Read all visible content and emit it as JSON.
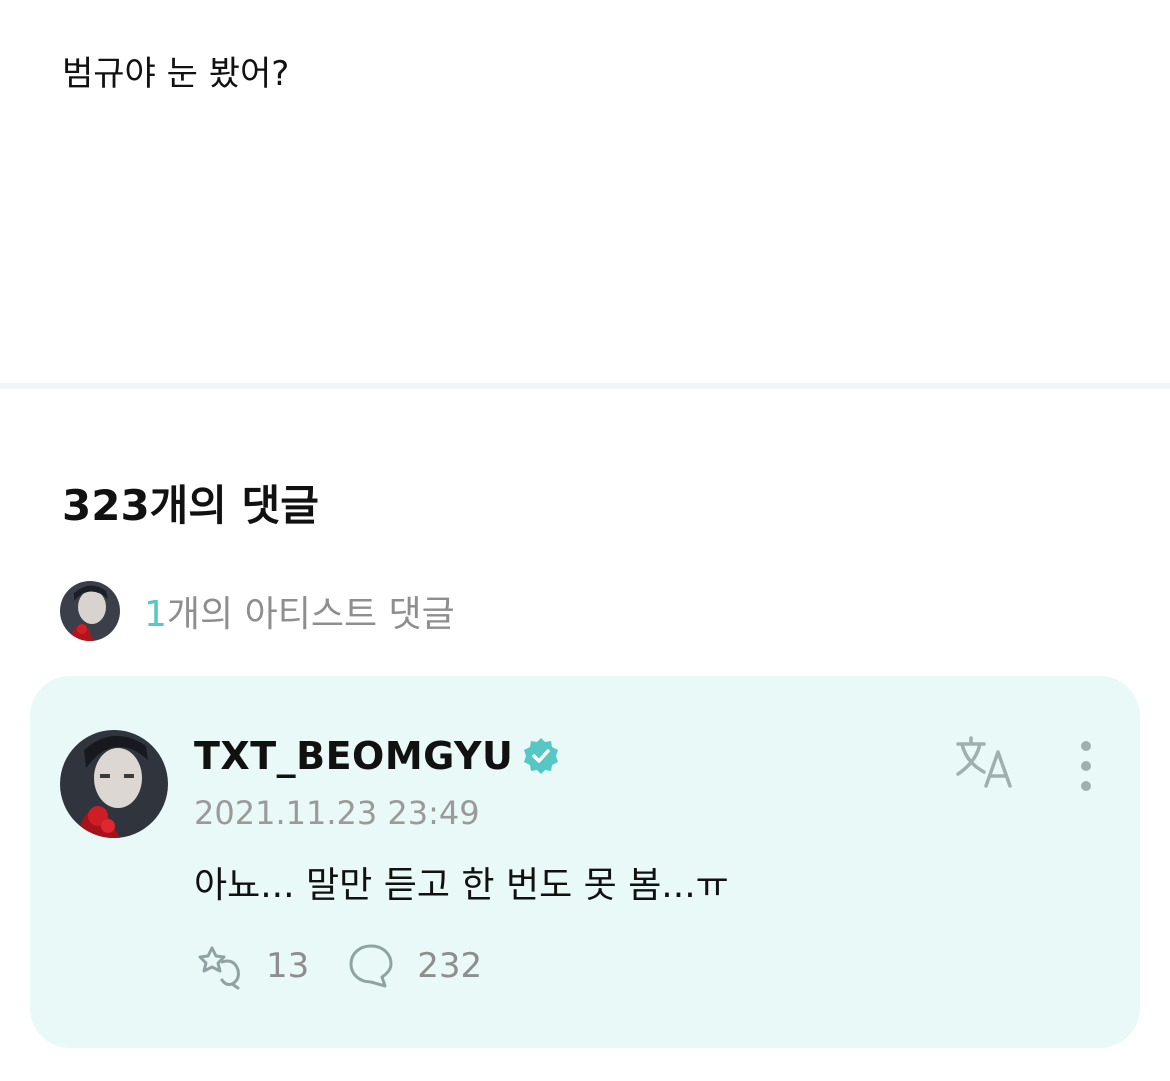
{
  "post": {
    "text": "범규야 눈 봤어?"
  },
  "comments": {
    "title": "323개의 댓글",
    "artist_summary_count": "1",
    "artist_summary_label": "개의 아티스트 댓글"
  },
  "artist_comment": {
    "author": "TXT_BEOMGYU",
    "timestamp": "2021.11.23 23:49",
    "body": "아뇨... 말만 듣고 한 번도 못 봄...ㅠ",
    "likes": "13",
    "replies": "232",
    "icons": {
      "verified": "verified-badge-icon",
      "translate": "translate-icon",
      "more": "more-vertical-icon",
      "like": "cheer-icon",
      "reply": "comment-bubble-icon"
    }
  },
  "colors": {
    "accent": "#56c7c4",
    "card_background": "#e9f9f7",
    "muted_text": "#8e8e8e"
  }
}
